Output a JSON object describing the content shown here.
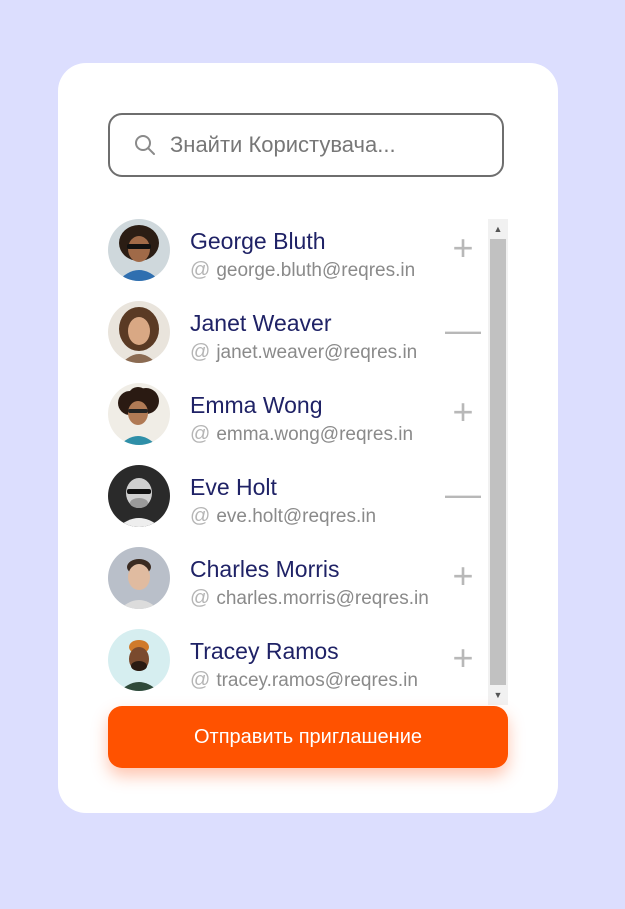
{
  "search": {
    "placeholder": "Знайти Користувача..."
  },
  "users": [
    {
      "name": "George Bluth",
      "email": "george.bluth@reqres.in",
      "action": "+"
    },
    {
      "name": "Janet Weaver",
      "email": "janet.weaver@reqres.in",
      "action": "—"
    },
    {
      "name": "Emma Wong",
      "email": "emma.wong@reqres.in",
      "action": "+"
    },
    {
      "name": "Eve Holt",
      "email": "eve.holt@reqres.in",
      "action": "—"
    },
    {
      "name": "Charles Morris",
      "email": "charles.morris@reqres.in",
      "action": "+"
    },
    {
      "name": "Tracey Ramos",
      "email": "tracey.ramos@reqres.in",
      "action": "+"
    }
  ],
  "email_prefix_icon": "@",
  "send_button": {
    "label": "Отправить приглашение"
  },
  "colors": {
    "background": "#dcdefe",
    "accent": "#ff5200",
    "name_text": "#1f2266",
    "email_text": "#8a8a8a"
  }
}
